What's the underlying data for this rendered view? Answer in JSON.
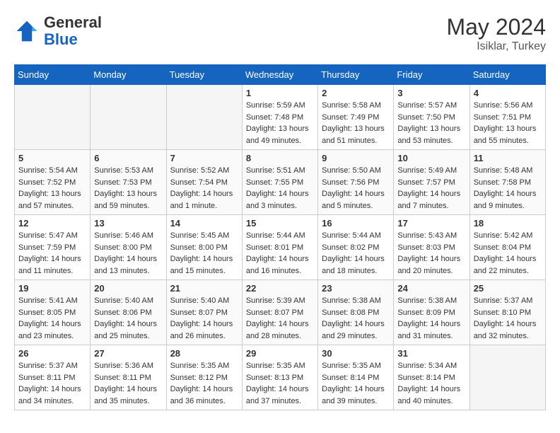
{
  "header": {
    "logo_general": "General",
    "logo_blue": "Blue",
    "month_year": "May 2024",
    "location": "Isiklar, Turkey"
  },
  "days_of_week": [
    "Sunday",
    "Monday",
    "Tuesday",
    "Wednesday",
    "Thursday",
    "Friday",
    "Saturday"
  ],
  "weeks": [
    [
      {
        "day": "",
        "empty": true
      },
      {
        "day": "",
        "empty": true
      },
      {
        "day": "",
        "empty": true
      },
      {
        "day": "1",
        "sunrise": "5:59 AM",
        "sunset": "7:48 PM",
        "daylight": "13 hours and 49 minutes."
      },
      {
        "day": "2",
        "sunrise": "5:58 AM",
        "sunset": "7:49 PM",
        "daylight": "13 hours and 51 minutes."
      },
      {
        "day": "3",
        "sunrise": "5:57 AM",
        "sunset": "7:50 PM",
        "daylight": "13 hours and 53 minutes."
      },
      {
        "day": "4",
        "sunrise": "5:56 AM",
        "sunset": "7:51 PM",
        "daylight": "13 hours and 55 minutes."
      }
    ],
    [
      {
        "day": "5",
        "sunrise": "5:54 AM",
        "sunset": "7:52 PM",
        "daylight": "13 hours and 57 minutes."
      },
      {
        "day": "6",
        "sunrise": "5:53 AM",
        "sunset": "7:53 PM",
        "daylight": "13 hours and 59 minutes."
      },
      {
        "day": "7",
        "sunrise": "5:52 AM",
        "sunset": "7:54 PM",
        "daylight": "14 hours and 1 minute."
      },
      {
        "day": "8",
        "sunrise": "5:51 AM",
        "sunset": "7:55 PM",
        "daylight": "14 hours and 3 minutes."
      },
      {
        "day": "9",
        "sunrise": "5:50 AM",
        "sunset": "7:56 PM",
        "daylight": "14 hours and 5 minutes."
      },
      {
        "day": "10",
        "sunrise": "5:49 AM",
        "sunset": "7:57 PM",
        "daylight": "14 hours and 7 minutes."
      },
      {
        "day": "11",
        "sunrise": "5:48 AM",
        "sunset": "7:58 PM",
        "daylight": "14 hours and 9 minutes."
      }
    ],
    [
      {
        "day": "12",
        "sunrise": "5:47 AM",
        "sunset": "7:59 PM",
        "daylight": "14 hours and 11 minutes."
      },
      {
        "day": "13",
        "sunrise": "5:46 AM",
        "sunset": "8:00 PM",
        "daylight": "14 hours and 13 minutes."
      },
      {
        "day": "14",
        "sunrise": "5:45 AM",
        "sunset": "8:00 PM",
        "daylight": "14 hours and 15 minutes."
      },
      {
        "day": "15",
        "sunrise": "5:44 AM",
        "sunset": "8:01 PM",
        "daylight": "14 hours and 16 minutes."
      },
      {
        "day": "16",
        "sunrise": "5:44 AM",
        "sunset": "8:02 PM",
        "daylight": "14 hours and 18 minutes."
      },
      {
        "day": "17",
        "sunrise": "5:43 AM",
        "sunset": "8:03 PM",
        "daylight": "14 hours and 20 minutes."
      },
      {
        "day": "18",
        "sunrise": "5:42 AM",
        "sunset": "8:04 PM",
        "daylight": "14 hours and 22 minutes."
      }
    ],
    [
      {
        "day": "19",
        "sunrise": "5:41 AM",
        "sunset": "8:05 PM",
        "daylight": "14 hours and 23 minutes."
      },
      {
        "day": "20",
        "sunrise": "5:40 AM",
        "sunset": "8:06 PM",
        "daylight": "14 hours and 25 minutes."
      },
      {
        "day": "21",
        "sunrise": "5:40 AM",
        "sunset": "8:07 PM",
        "daylight": "14 hours and 26 minutes."
      },
      {
        "day": "22",
        "sunrise": "5:39 AM",
        "sunset": "8:07 PM",
        "daylight": "14 hours and 28 minutes."
      },
      {
        "day": "23",
        "sunrise": "5:38 AM",
        "sunset": "8:08 PM",
        "daylight": "14 hours and 29 minutes."
      },
      {
        "day": "24",
        "sunrise": "5:38 AM",
        "sunset": "8:09 PM",
        "daylight": "14 hours and 31 minutes."
      },
      {
        "day": "25",
        "sunrise": "5:37 AM",
        "sunset": "8:10 PM",
        "daylight": "14 hours and 32 minutes."
      }
    ],
    [
      {
        "day": "26",
        "sunrise": "5:37 AM",
        "sunset": "8:11 PM",
        "daylight": "14 hours and 34 minutes."
      },
      {
        "day": "27",
        "sunrise": "5:36 AM",
        "sunset": "8:11 PM",
        "daylight": "14 hours and 35 minutes."
      },
      {
        "day": "28",
        "sunrise": "5:35 AM",
        "sunset": "8:12 PM",
        "daylight": "14 hours and 36 minutes."
      },
      {
        "day": "29",
        "sunrise": "5:35 AM",
        "sunset": "8:13 PM",
        "daylight": "14 hours and 37 minutes."
      },
      {
        "day": "30",
        "sunrise": "5:35 AM",
        "sunset": "8:14 PM",
        "daylight": "14 hours and 39 minutes."
      },
      {
        "day": "31",
        "sunrise": "5:34 AM",
        "sunset": "8:14 PM",
        "daylight": "14 hours and 40 minutes."
      },
      {
        "day": "",
        "empty": true
      }
    ]
  ],
  "labels": {
    "sunrise": "Sunrise:",
    "sunset": "Sunset:",
    "daylight": "Daylight:"
  }
}
